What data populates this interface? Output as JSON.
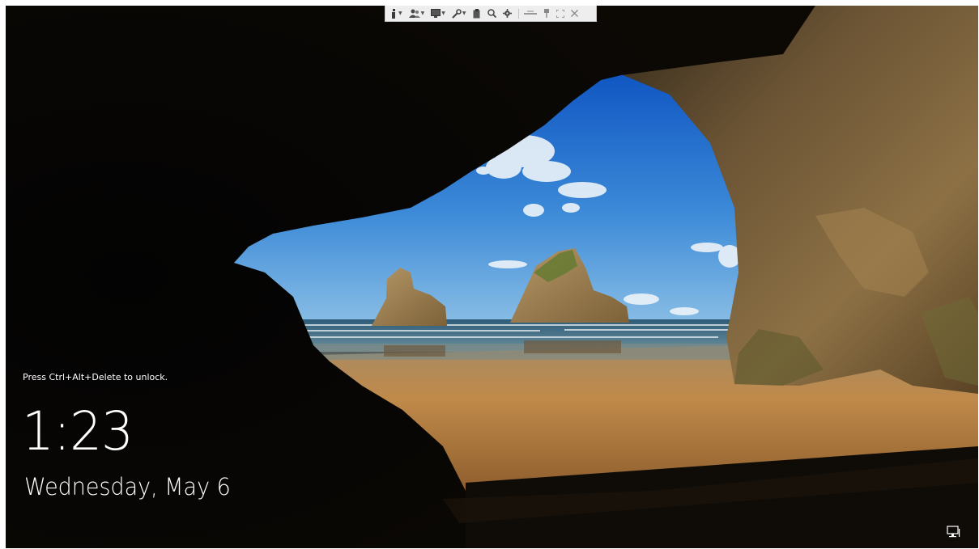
{
  "lock_screen": {
    "unlock_hint": "Press Ctrl+Alt+Delete to unlock.",
    "time": "1:23",
    "date": "Wednesday, May 6",
    "network_icon": "network-monitor-icon"
  },
  "toolbar": {
    "buttons": [
      {
        "name": "info-menu",
        "icon": "info-icon",
        "has_dropdown": true
      },
      {
        "name": "users-menu",
        "icon": "users-icon",
        "has_dropdown": true
      },
      {
        "name": "display-menu",
        "icon": "monitor-icon",
        "has_dropdown": true
      },
      {
        "name": "tools-menu",
        "icon": "wrench-icon",
        "has_dropdown": true
      },
      {
        "name": "clipboard",
        "icon": "clipboard-icon",
        "has_dropdown": false
      },
      {
        "name": "zoom",
        "icon": "magnifier-icon",
        "has_dropdown": false
      },
      {
        "name": "settings",
        "icon": "gear-icon",
        "has_dropdown": false
      },
      {
        "name": "minimize",
        "icon": "minimize-bar-icon",
        "has_dropdown": false
      },
      {
        "name": "pin",
        "icon": "pin-icon",
        "has_dropdown": false
      },
      {
        "name": "fullscreen",
        "icon": "expand-icon",
        "has_dropdown": false
      },
      {
        "name": "close",
        "icon": "close-icon",
        "has_dropdown": false
      }
    ]
  },
  "colors": {
    "text": "#ffffff",
    "sky_top": "#1a62c7",
    "sky_bottom": "#7fb7e4",
    "sand": "#b98748",
    "cave": "#050505",
    "toolbar_bg": "#eeeeee"
  }
}
